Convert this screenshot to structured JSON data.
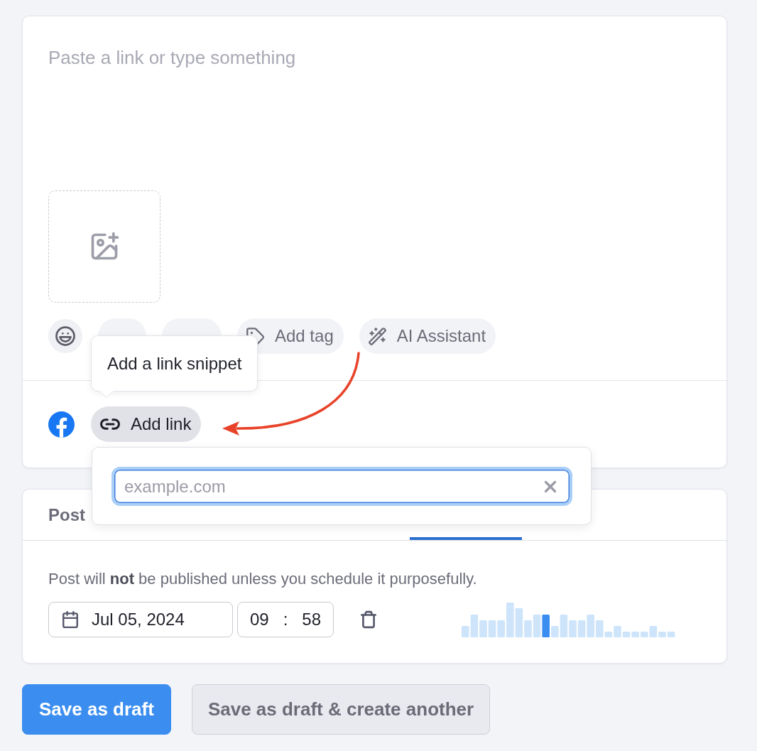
{
  "composer": {
    "text_placeholder": "Paste a link or type something",
    "toolbar": [
      {
        "kind": "emoji"
      },
      {
        "kind": "text"
      },
      {
        "kind": "text"
      },
      {
        "kind": "tag",
        "label": "Add tag"
      },
      {
        "kind": "ai",
        "label": "AI Assistant"
      }
    ],
    "tooltip": "Add a link snippet",
    "add_link": {
      "label": "Add link",
      "active": true
    },
    "link_popover": {
      "placeholder": "example.com"
    }
  },
  "tabs": [
    {
      "label": "Post",
      "selected": false
    },
    {
      "selected": true
    }
  ],
  "schedule": {
    "notice": "Post will **not** be published unless you schedule it purposefully.",
    "date": "Jul 05, 2024",
    "time": {
      "hours": "09",
      "separator": ":",
      "minutes": "58"
    }
  },
  "buttons": [
    {
      "kind": "primary",
      "label": "Save as draft"
    },
    {
      "kind": "secondary",
      "label": "Save as draft & create another"
    }
  ]
}
